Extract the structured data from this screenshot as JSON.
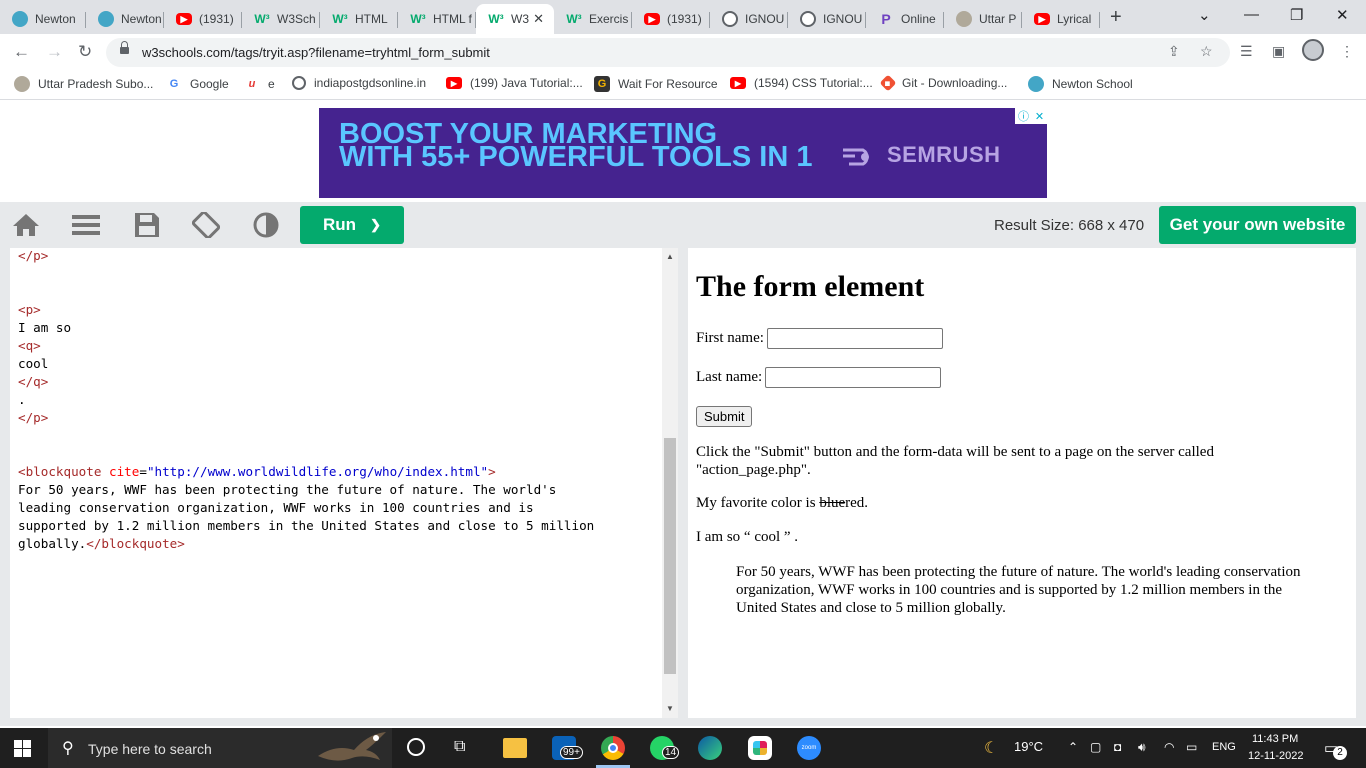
{
  "browser": {
    "tabs": [
      {
        "title": "Newton",
        "icon": "newton-icon"
      },
      {
        "title": "Newton",
        "icon": "newton-icon"
      },
      {
        "title": "(1931)",
        "icon": "youtube-icon"
      },
      {
        "title": "W3Sch",
        "icon": "w3schools-icon"
      },
      {
        "title": "HTML",
        "icon": "w3schools-icon"
      },
      {
        "title": "HTML f",
        "icon": "w3schools-icon"
      },
      {
        "title": "W3",
        "icon": "w3schools-icon",
        "active": true
      },
      {
        "title": "Exercis",
        "icon": "w3schools-icon"
      },
      {
        "title": "(1931)",
        "icon": "youtube-icon"
      },
      {
        "title": "IGNOU",
        "icon": "globe-icon"
      },
      {
        "title": "IGNOU",
        "icon": "globe-icon"
      },
      {
        "title": "Online",
        "icon": "p-icon"
      },
      {
        "title": "Uttar P",
        "icon": "uttar-icon"
      },
      {
        "title": "Lyrical",
        "icon": "youtube-icon"
      }
    ],
    "url": "w3schools.com/tags/tryit.asp?filename=tryhtml_form_submit",
    "bookmarks": [
      {
        "label": "Uttar Pradesh Subo...",
        "icon": "uttar-icon"
      },
      {
        "label": "Google",
        "icon": "google-icon"
      },
      {
        "label": "e",
        "icon": "u-icon"
      },
      {
        "label": "indiapostgdsonline.in",
        "icon": "globe-icon"
      },
      {
        "label": "(199) Java Tutorial:...",
        "icon": "youtube-icon"
      },
      {
        "label": "Wait For Resource",
        "icon": "g-icon"
      },
      {
        "label": "(1594) CSS Tutorial:...",
        "icon": "youtube-icon"
      },
      {
        "label": "Git - Downloading...",
        "icon": "git-icon"
      },
      {
        "label": "Newton School",
        "icon": "newton-icon"
      }
    ]
  },
  "ad": {
    "line1": "BOOST YOUR MARKETING",
    "line2": "WITH 55+ POWERFUL TOOLS IN 1",
    "brand": "SEMRUSH"
  },
  "w3": {
    "run_label": "Run",
    "run_chevron": "❯",
    "result_size": "Result Size: 668 x 470",
    "get_site_label": "Get your own website"
  },
  "editor": {
    "lines": [
      "</p>",
      "",
      "",
      "<p>",
      "I am so",
      "<q>",
      "cool",
      "</q>",
      ".",
      "</p>",
      "",
      "",
      "<blockquote cite=\"http://www.worldwildlife.org/who/index.html\">",
      "For 50 years, WWF has been protecting the future of nature. The world's",
      "leading conservation organization, WWF works in 100 countries and is",
      "supported by 1.2 million members in the United States and close to 5 million",
      "globally.</blockquote>"
    ]
  },
  "result": {
    "heading": "The form element",
    "first_name_label": "First name:",
    "last_name_label": "Last name:",
    "submit_label": "Submit",
    "info_text": "Click the \"Submit\" button and the form-data will be sent to a page on the server called \"action_page.php\".",
    "color_prefix": "My favorite color is ",
    "color_deleted": "blue",
    "color_inserted": "red",
    "color_suffix": ".",
    "quote_prefix": "I am so “ cool ” .",
    "blockquote": "For 50 years, WWF has been protecting the future of nature. The world's leading conservation organization, WWF works in 100 countries and is supported by 1.2 million members in the United States and close to 5 million globally."
  },
  "taskbar": {
    "search_placeholder": "Type here to search",
    "weather": "19°C",
    "language": "ENG",
    "time": "11:43 PM",
    "date": "12-11-2022",
    "file_badge": "99+",
    "whatsapp_badge": "14",
    "notification_badge": "2",
    "zoom_label": "zoom"
  },
  "colors": {
    "w3_green": "#04aa6d",
    "ad_purple": "#45238f",
    "taskbar": "#1f1f1f"
  }
}
